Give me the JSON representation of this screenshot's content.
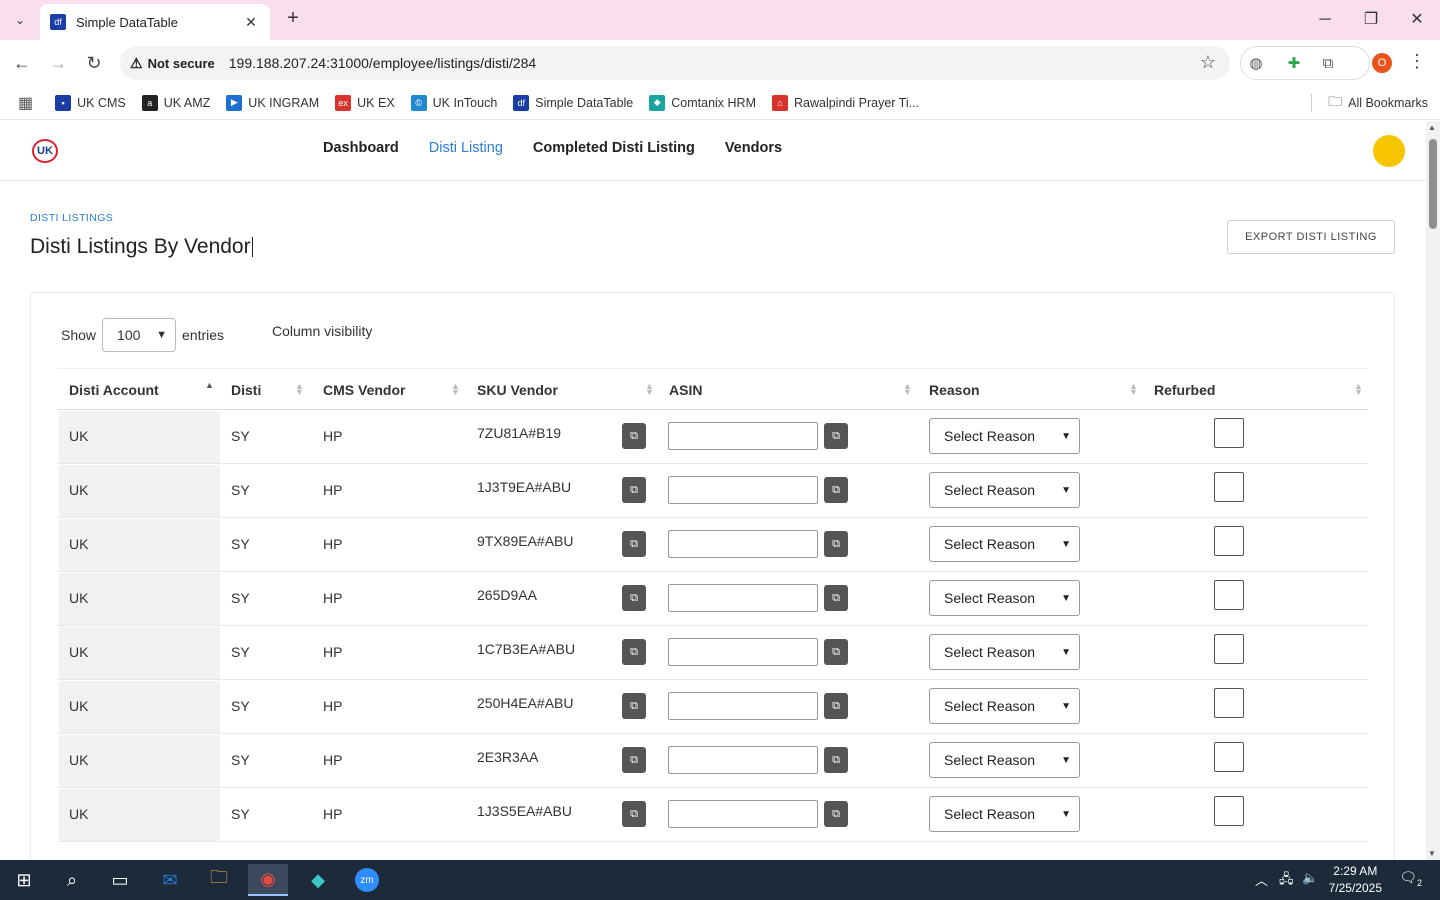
{
  "browser": {
    "tab_title": "Simple DataTable",
    "tab_favicon": "df",
    "security_label": "Not secure",
    "url": "199.188.207.24:31000/employee/listings/disti/284",
    "profile_initial": "O",
    "bookmarks": [
      {
        "label": "UK CMS",
        "color": "#1a3ea6",
        "glyph": "▪"
      },
      {
        "label": "UK AMZ",
        "color": "#222222",
        "glyph": "a"
      },
      {
        "label": "UK INGRAM",
        "color": "#1f6fd1",
        "glyph": "▶"
      },
      {
        "label": "UK EX",
        "color": "#d9322a",
        "glyph": "ex"
      },
      {
        "label": "UK InTouch",
        "color": "#1f8ad1",
        "glyph": "©"
      },
      {
        "label": "Simple DataTable",
        "color": "#1a3ea6",
        "glyph": "df"
      },
      {
        "label": "Comtanix HRM",
        "color": "#1aa3a3",
        "glyph": "◆"
      },
      {
        "label": "Rawalpindi Prayer Ti...",
        "color": "#d9322a",
        "glyph": "⌂"
      }
    ],
    "all_bookmarks": "All Bookmarks"
  },
  "app": {
    "logo_text": "UK",
    "nav": [
      "Dashboard",
      "Disti Listing",
      "Completed Disti Listing",
      "Vendors"
    ],
    "active_nav_index": 1,
    "breadcrumb": "DISTI LISTINGS",
    "title": "Disti Listings By Vendor",
    "export_button": "EXPORT DISTI LISTING"
  },
  "table_controls": {
    "show_label": "Show",
    "entries_value": "100",
    "entries_label": "entries",
    "column_visibility": "Column visibility"
  },
  "table": {
    "headers": [
      "Disti Account",
      "Disti",
      "CMS Vendor",
      "SKU Vendor",
      "ASIN",
      "Reason",
      "Refurbed"
    ],
    "reason_placeholder": "Select Reason",
    "rows": [
      {
        "account": "UK",
        "disti": "SY",
        "vendor": "HP",
        "sku": "7ZU81A#B19",
        "asin": ""
      },
      {
        "account": "UK",
        "disti": "SY",
        "vendor": "HP",
        "sku": "1J3T9EA#ABU",
        "asin": ""
      },
      {
        "account": "UK",
        "disti": "SY",
        "vendor": "HP",
        "sku": "9TX89EA#ABU",
        "asin": ""
      },
      {
        "account": "UK",
        "disti": "SY",
        "vendor": "HP",
        "sku": "265D9AA",
        "asin": ""
      },
      {
        "account": "UK",
        "disti": "SY",
        "vendor": "HP",
        "sku": "1C7B3EA#ABU",
        "asin": ""
      },
      {
        "account": "UK",
        "disti": "SY",
        "vendor": "HP",
        "sku": "250H4EA#ABU",
        "asin": ""
      },
      {
        "account": "UK",
        "disti": "SY",
        "vendor": "HP",
        "sku": "2E3R3AA",
        "asin": ""
      },
      {
        "account": "UK",
        "disti": "SY",
        "vendor": "HP",
        "sku": "1J3S5EA#ABU",
        "asin": ""
      }
    ]
  },
  "taskbar": {
    "time": "2:29 AM",
    "date": "7/25/2025",
    "notification_count": "2"
  }
}
